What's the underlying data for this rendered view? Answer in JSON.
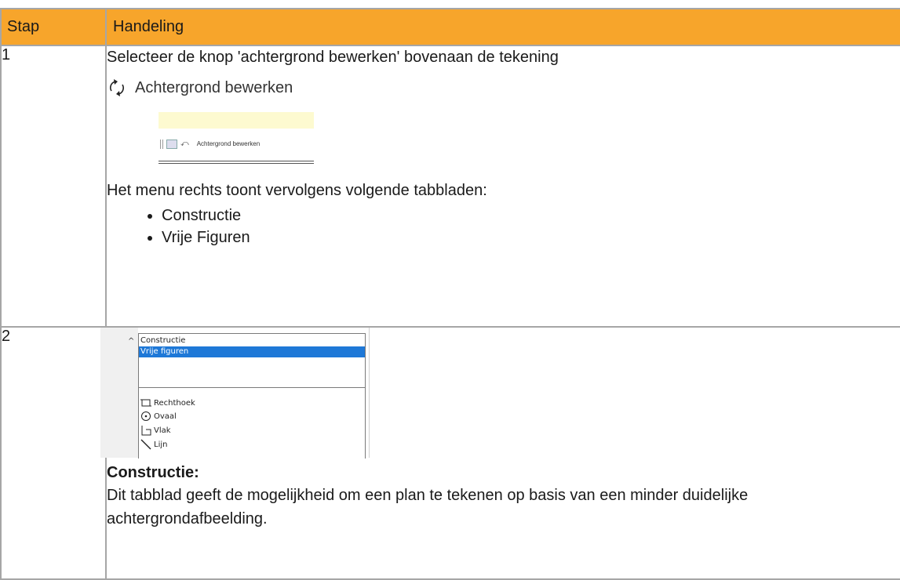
{
  "table": {
    "headers": {
      "step": "Stap",
      "action": "Handeling"
    },
    "rows": [
      {
        "step": "1",
        "instruction": "Selecteer de knop 'achtergrond bewerken' bovenaan de tekening",
        "button_label": "Achtergrond bewerken",
        "toolbar_label": "Achtergrond bewerken",
        "menu_intro": "Het menu rechts toont vervolgens volgende tabbladen:",
        "tabs": [
          "Constructie",
          "Vrije Figuren"
        ]
      },
      {
        "step": "2",
        "panel": {
          "items": [
            "Constructie",
            "Vrije figuren"
          ],
          "tools": [
            "Rechthoek",
            "Ovaal",
            "Vlak",
            "Lijn"
          ]
        },
        "section_title": "Constructie:",
        "description": "Dit tabblad geeft de mogelijkheid om een plan te tekenen op basis van een minder duidelijke achtergrondafbeelding."
      }
    ]
  },
  "colors": {
    "header_bg": "#f7a52b",
    "selection": "#1e78d7",
    "border": "#a6a6a6"
  },
  "icons": [
    "refresh-icon",
    "image-icon",
    "undo-icon",
    "chevron-up-icon",
    "rectangle-icon",
    "oval-icon",
    "area-icon",
    "line-icon"
  ]
}
